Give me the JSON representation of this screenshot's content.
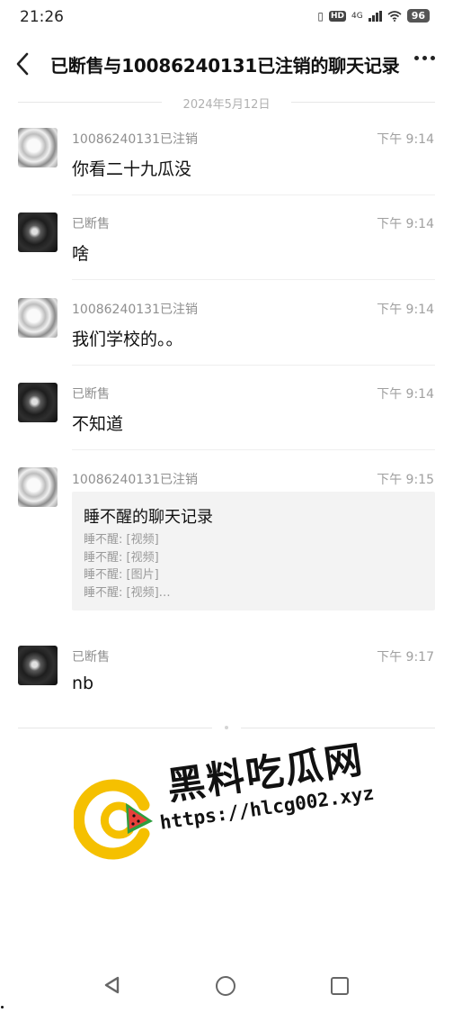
{
  "status_bar": {
    "time": "21:26",
    "vibrate_icon": "vibrate-icon",
    "hd_label": "HD",
    "network": "4G",
    "battery": "96"
  },
  "header": {
    "title": "已断售与10086240131已注销的聊天记录",
    "back_icon": "chevron-left-icon",
    "more_icon": "more-dots-icon"
  },
  "date_separator": "2024年5月12日",
  "messages": [
    {
      "sender": "10086240131已注销",
      "time": "下午 9:14",
      "text": "你看二十九瓜没"
    },
    {
      "sender": "已断售",
      "time": "下午 9:14",
      "text": "啥"
    },
    {
      "sender": "10086240131已注销",
      "time": "下午 9:14",
      "text": "我们学校的。。"
    },
    {
      "sender": "已断售",
      "time": "下午 9:14",
      "text": "不知道"
    },
    {
      "sender": "10086240131已注销",
      "time": "下午 9:15",
      "record": {
        "title": "睡不醒的聊天记录",
        "lines": [
          "睡不醒: [视频]",
          "睡不醒: [视频]",
          "睡不醒: [图片]",
          "睡不醒: [视频]…"
        ]
      }
    },
    {
      "sender": "已断售",
      "time": "下午 9:17",
      "text": "nb"
    }
  ],
  "watermark": {
    "name": "黑料吃瓜网",
    "url": "https://hlcg002.xyz",
    "colors": {
      "ring": "#f5c000",
      "melon_rind": "#2e9e3e",
      "melon_flesh": "#e8403a"
    }
  },
  "nav_bar": {
    "back_icon": "nav-back-icon",
    "home_icon": "nav-home-icon",
    "recent_icon": "nav-recent-apps-icon"
  }
}
